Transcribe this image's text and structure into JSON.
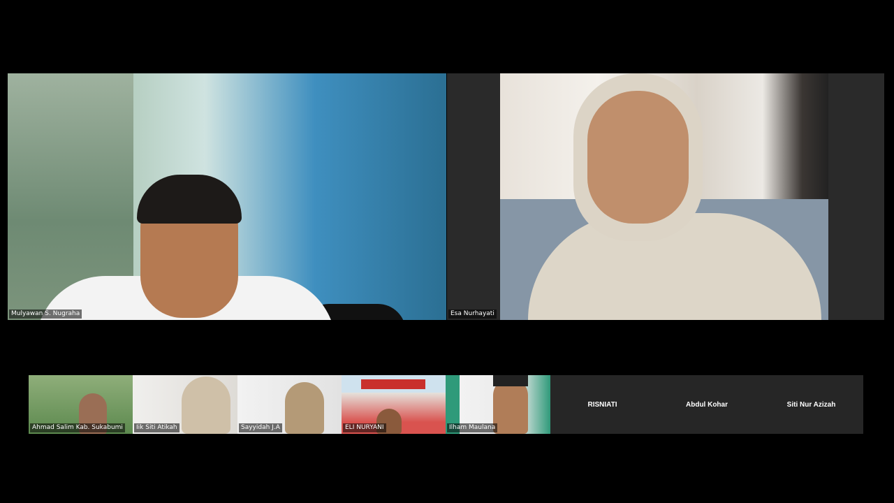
{
  "speakers": [
    {
      "name": "Mulyawan S. Nugraha"
    },
    {
      "name": "Esa Nurhayati"
    }
  ],
  "gallery": [
    {
      "name": "Ahmad Salim Kab. Sukabumi"
    },
    {
      "name": "Iik Siti Atikah"
    },
    {
      "name": "Sayyidah J.A"
    },
    {
      "name": "ELI NURYANI"
    },
    {
      "name": "Ilham Maulana"
    }
  ],
  "no_video": [
    {
      "name": "RISNIATI"
    },
    {
      "name": "Abdul Kohar"
    },
    {
      "name": "Siti Nur Azizah"
    }
  ]
}
